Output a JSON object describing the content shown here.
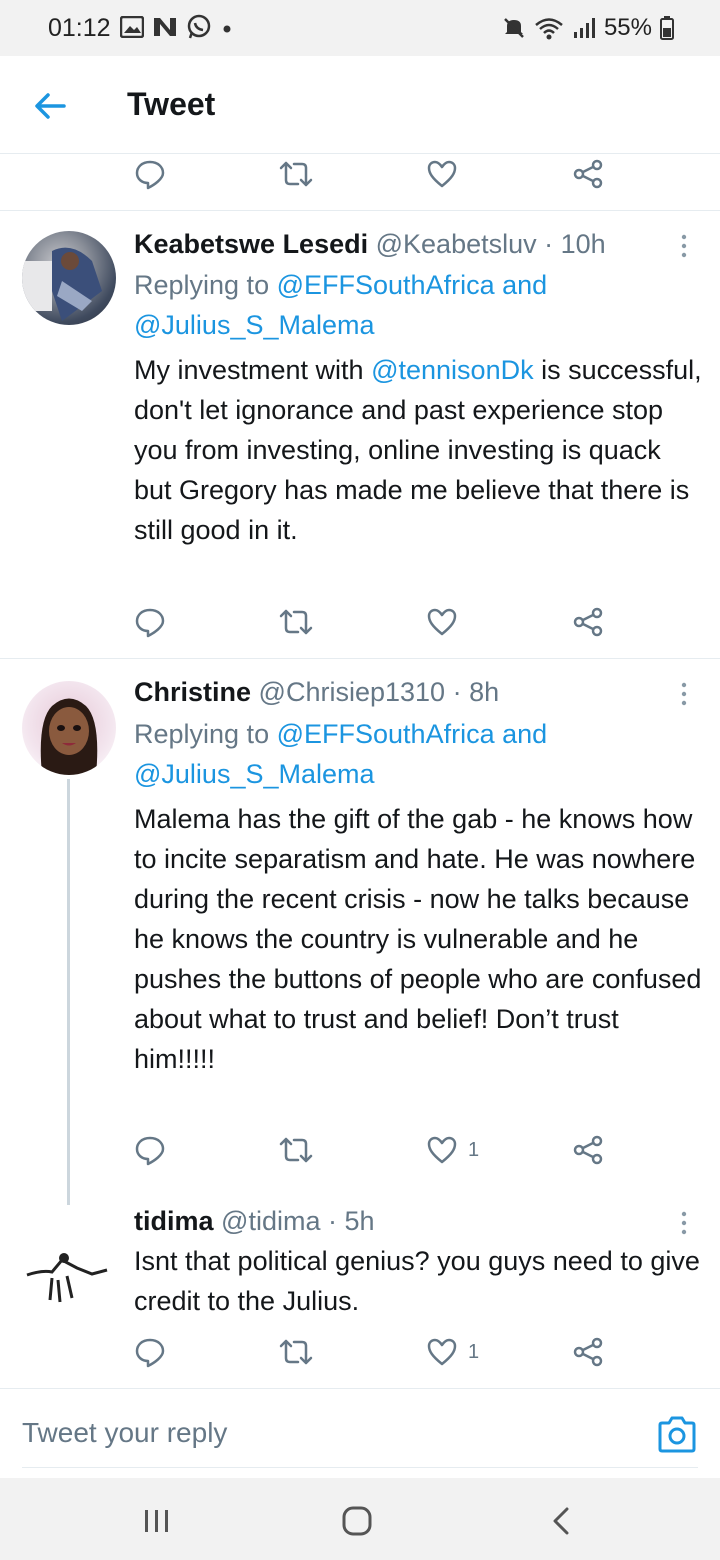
{
  "status_bar": {
    "time": "01:12",
    "battery": "55%",
    "icons": [
      "gallery-icon",
      "n-icon",
      "whatsapp-icon",
      "dot-icon",
      "mute-icon",
      "wifi-icon",
      "signal-icon",
      "battery-icon"
    ]
  },
  "header": {
    "title": "Tweet",
    "back_icon": "arrow-left-icon"
  },
  "tweets": [
    {
      "name": "Keabetswe Lesedi",
      "handle": "@Keabetsluv",
      "time": "· 10h",
      "replying_prefix": "Replying to",
      "replying_to_1": "@EFFSouthAfrica",
      "replying_and": "and",
      "replying_to_2": "@Julius_S_Malema",
      "text_before": "My investment with",
      "mention": "@tennisonDk",
      "text_after": "is successful, don't let ignorance and past experience stop you from investing, online investing is quack but Gregory has made me believe that there is still good in it.",
      "likes": ""
    },
    {
      "name": "Christine",
      "handle": "@Chrisiep1310",
      "time": "· 8h",
      "replying_prefix": "Replying to",
      "replying_to_1": "@EFFSouthAfrica",
      "replying_and": "and",
      "replying_to_2": "@Julius_S_Malema",
      "text": "Malema has the gift of the gab - he knows how to incite separatism and hate. He was nowhere during the recent crisis - now he talks because he knows the country is vulnerable and he pushes the buttons of people who are confused about what to trust and belief! Don’t trust him!!!!!",
      "likes": "1"
    },
    {
      "name": "tidima",
      "handle": "@tidima",
      "time": "· 5h",
      "text": "Isnt that political genius? you guys need to give credit to the Julius.",
      "likes": "1"
    }
  ],
  "reply_bar": {
    "placeholder": "Tweet your reply",
    "camera_icon": "camera-icon"
  },
  "nav_bar": {
    "icons": [
      "recent-apps-icon",
      "home-icon",
      "back-icon"
    ]
  },
  "colors": {
    "link": "#1b95e0",
    "secondary_text": "#657786",
    "primary_text": "#14171a",
    "divider": "#e6ecf0"
  }
}
